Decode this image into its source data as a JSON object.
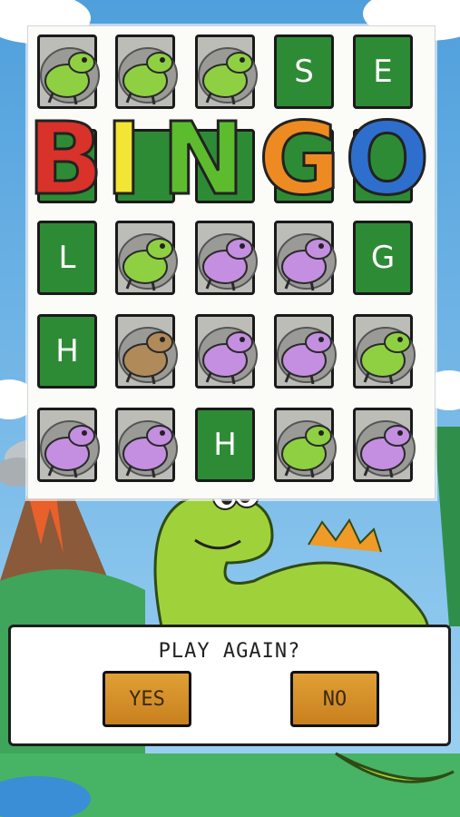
{
  "game": {
    "title_letters": [
      "B",
      "I",
      "N",
      "G",
      "O"
    ],
    "title_colors": [
      "#d8322a",
      "#f2e533",
      "#5cbc2e",
      "#ee8a22",
      "#2e6fce"
    ],
    "grid": [
      [
        {
          "type": "piece",
          "kind": "green-dino"
        },
        {
          "type": "piece",
          "kind": "green-trex"
        },
        {
          "type": "piece",
          "kind": "green-trex"
        },
        {
          "type": "letter",
          "letter": "S"
        },
        {
          "type": "letter",
          "letter": "E"
        }
      ],
      [
        {
          "type": "letter",
          "letter": ""
        },
        {
          "type": "letter",
          "letter": ""
        },
        {
          "type": "letter",
          "letter": ""
        },
        {
          "type": "letter",
          "letter": ""
        },
        {
          "type": "letter",
          "letter": ""
        }
      ],
      [
        {
          "type": "letter",
          "letter": "L"
        },
        {
          "type": "piece",
          "kind": "green-trex"
        },
        {
          "type": "piece",
          "kind": "purple-ptero"
        },
        {
          "type": "piece",
          "kind": "purple-triceratops"
        },
        {
          "type": "letter",
          "letter": "G"
        }
      ],
      [
        {
          "type": "letter",
          "letter": "H"
        },
        {
          "type": "piece",
          "kind": "brown-trex"
        },
        {
          "type": "piece",
          "kind": "purple-triceratops"
        },
        {
          "type": "piece",
          "kind": "purple-ptero"
        },
        {
          "type": "piece",
          "kind": "green-trex"
        }
      ],
      [
        {
          "type": "piece",
          "kind": "purple-triceratops"
        },
        {
          "type": "piece",
          "kind": "purple-triceratops"
        },
        {
          "type": "letter",
          "letter": "H"
        },
        {
          "type": "piece",
          "kind": "green-dino"
        },
        {
          "type": "piece",
          "kind": "purple-triceratops"
        }
      ]
    ]
  },
  "dialog": {
    "question": "PLAY AGAIN?",
    "yes_label": "YES",
    "no_label": "NO"
  }
}
